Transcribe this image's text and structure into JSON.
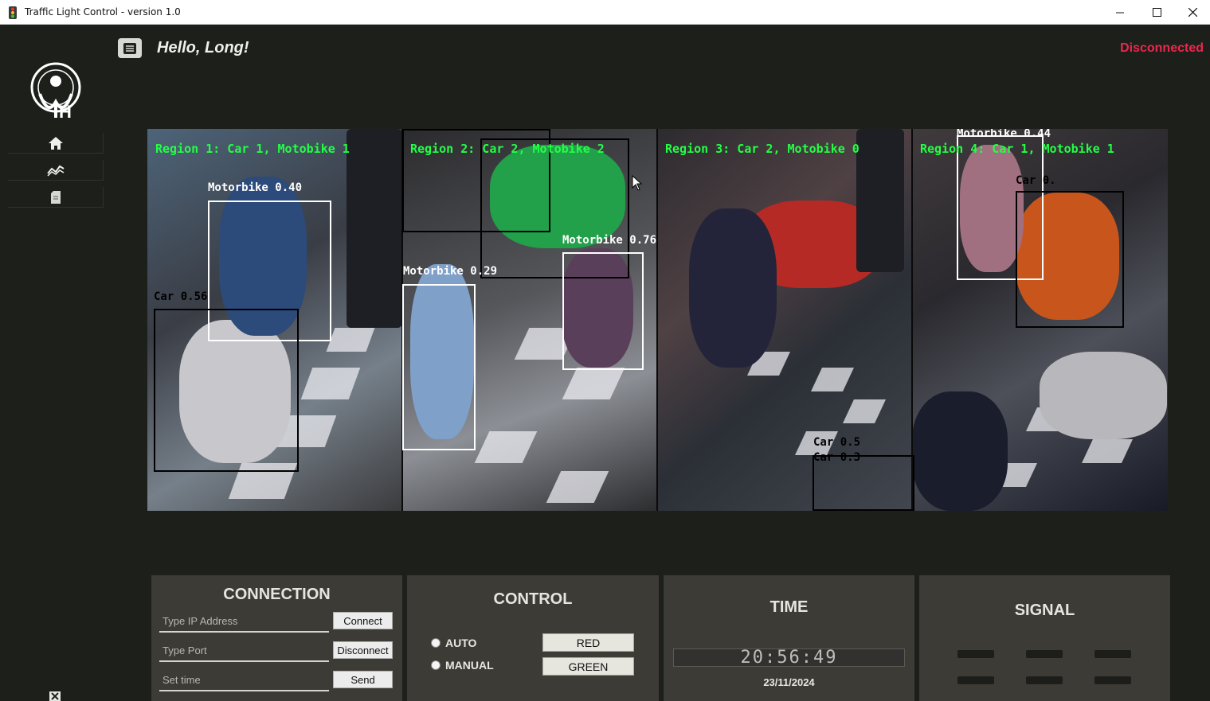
{
  "window": {
    "title": "Traffic Light Control - version 1.0"
  },
  "header": {
    "greeting": "Hello, Long!",
    "status": "Disconnected",
    "status_color": "#e8294d"
  },
  "sidebar": {
    "logo_icon": "university-logo-icon",
    "items": [
      {
        "icon": "home-icon"
      },
      {
        "icon": "chart-icon"
      },
      {
        "icon": "document-icon"
      }
    ]
  },
  "video": {
    "regions": [
      {
        "label": "Region 1: Car 1, Motobike 1"
      },
      {
        "label": "Region 2: Car 2, Motobike 2"
      },
      {
        "label": "Region 3: Car 2, Motobike 0"
      },
      {
        "label": "Region 4: Car 1, Motobike 1"
      }
    ],
    "detections": [
      {
        "label": "Motorbike 0.40",
        "color": "white"
      },
      {
        "label": "Car 0.56",
        "color": "black"
      },
      {
        "label": "Motorbike 0.29",
        "color": "white"
      },
      {
        "label": "Motorbike 0.76",
        "color": "white"
      },
      {
        "label": "Car 0.5",
        "color": "black"
      },
      {
        "label": "Car 0.3",
        "color": "black"
      },
      {
        "label": "Motorbike 0.44",
        "color": "white"
      },
      {
        "label": "Car 0.",
        "color": "black"
      }
    ]
  },
  "connection": {
    "title": "CONNECTION",
    "ip_placeholder": "Type IP Address",
    "port_placeholder": "Type Port",
    "time_placeholder": "Set time",
    "connect_label": "Connect",
    "disconnect_label": "Disconnect",
    "send_label": "Send"
  },
  "control": {
    "title": "CONTROL",
    "auto_label": "AUTO",
    "manual_label": "MANUAL",
    "red_label": "RED",
    "green_label": "GREEN"
  },
  "time": {
    "title": "TIME",
    "clock": "20:56:49",
    "date": "23/11/2024"
  },
  "signal": {
    "title": "SIGNAL"
  }
}
